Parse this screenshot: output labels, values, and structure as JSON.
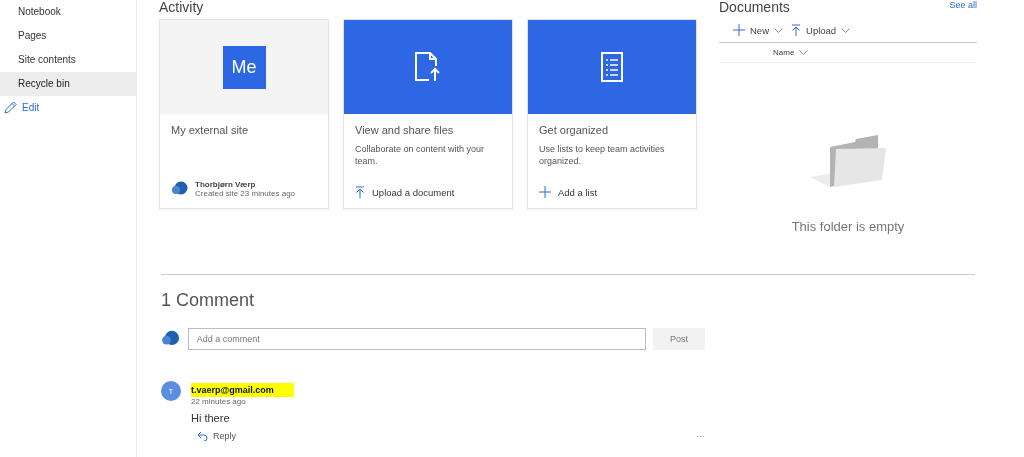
{
  "sidebar": {
    "items": [
      {
        "label": "Notebook",
        "selected": false
      },
      {
        "label": "Pages",
        "selected": false
      },
      {
        "label": "Site contents",
        "selected": false
      },
      {
        "label": "Recycle bin",
        "selected": true
      }
    ],
    "edit_link": "Edit"
  },
  "activity": {
    "title": "Activity",
    "cards": [
      {
        "kind": "site",
        "tile_text": "Me",
        "title": "My external site",
        "author": "Thorbjørn Værp",
        "meta": "Created site 23 minutes ago"
      },
      {
        "kind": "files",
        "title": "View and share files",
        "description": "Collaborate on content with your team.",
        "action": "Upload a document"
      },
      {
        "kind": "list",
        "title": "Get organized",
        "description": "Use lists to keep team activities organized.",
        "action": "Add a list"
      }
    ]
  },
  "documents": {
    "title": "Documents",
    "see_all": "See all",
    "toolbar": [
      "New",
      "Upload"
    ],
    "column": "Name",
    "empty_text": "This folder is empty"
  },
  "comments": {
    "title": "1 Comment",
    "input": {
      "placeholder": "Add a comment"
    },
    "post_button": "Post",
    "items": [
      {
        "initial": "T",
        "author": "t.vaerp@gmail.com",
        "time": "22 minutes ago",
        "text": "Hi there",
        "reply": "Reply",
        "more": "···"
      }
    ]
  }
}
